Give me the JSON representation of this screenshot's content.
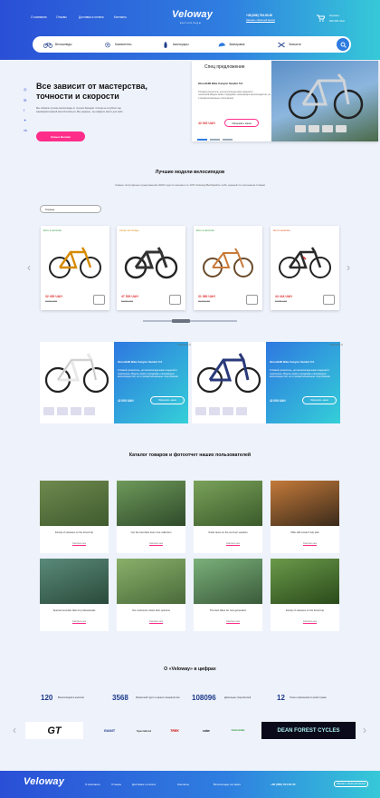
{
  "header": {
    "nav": [
      "О компании",
      "Отзывы",
      "Доставка и оплата",
      "Контакты"
    ],
    "logo": "Veloway",
    "logo_sub": "велосипеды",
    "phone": "+38 (066) 794-50-50",
    "callback": "Заказать обратный звонок",
    "cart_label": "Корзина",
    "cart_sum": "000 000 UAH"
  },
  "categories": [
    "Велосипеды",
    "Компоненты",
    "Аксессуары",
    "Экипировка",
    "Запчасти"
  ],
  "hero": {
    "title": "Все зависит от мастерства, точности и скорости",
    "text": "Мы собрали лучшие велосипеды от лучших брендов. Слоган не в рублях: мы занимаемся вашей мечтой кататься. Мы уверены - вы найдёте место для себя.",
    "button": "Новые Велики"
  },
  "offer": {
    "heading": "Спец предложение",
    "name": "Ghost/Hill Bike Canyon Sender 5.0",
    "desc": "Топовый ускоритель, для велосипеда каких моделей и чемпионов.Модель может порадовать начинающих велосипедистов, но и профессиональных спортсменов.",
    "price": "42 000 UAH",
    "button": "Оформить заказ"
  },
  "best": {
    "title": "Лучшие модели велосипедов",
    "subtitle": "Самые популярные предложения 2020 года по мнению по 10% Veloway.Выбирайте себе нужный по ключевым словам",
    "select": "Горные",
    "products": [
      {
        "badge": "Есть в наличии",
        "badge_color": "#2a9a3a",
        "price": "32 450 UAH",
        "old": "33 900 UAH"
      },
      {
        "badge": "Скоро на складе",
        "badge_color": "#d68a00",
        "price": "47 530 UAH",
        "old": "53 960 UAH"
      },
      {
        "badge": "Есть в наличии",
        "badge_color": "#2a9a3a",
        "price": "31 980 UAH",
        "old": "38 200 UAH"
      },
      {
        "badge": "Нет в наличии",
        "badge_color": "#e05020",
        "price": "44 444 UAH",
        "old": "48 875 UAH"
      }
    ]
  },
  "featured": [
    {
      "tag": "Новинка в 1х",
      "name": "Ghost/Hill Bike Canyon Sender 5.0",
      "desc": "Топовый ускоритель, для велосипеда каких моделей и чемпионов. Модель может порадовать начинающих велосипедистов, но и профессиональных спортсменов.",
      "price": "42 000 UAH",
      "button": "Оформить заказ"
    },
    {
      "tag": "Новинка в 1х",
      "name": "Ghost/Hill Bike Canyon Sender 5.0",
      "desc": "Топовый ускоритель, для велосипеда каких моделей и чемпионов. Модель может порадовать начинающих велосипедистов, но и профессиональных спортсменов.",
      "price": "42 000 UAH",
      "button": "Оформить заказ"
    }
  ],
  "gallery": {
    "title": "Каталог товаров и фотоотчет наших пользователей",
    "link": "Смотреть все",
    "items": [
      "Family of velosses on the forest trip",
      "Our the best bike lover nice collection",
      "Smile races on the summer vacation",
      "Offer still remain’t tidy plan",
      "Special mountain bike for professionals",
      "Our customers share their opinions",
      "The best bikes for new generation",
      "Family of velosses on the forest trip"
    ]
  },
  "stats": {
    "title": "О «Veloway» в цифрах",
    "items": [
      {
        "n": "120",
        "t": "Велосипедов в наличии"
      },
      {
        "n": "3568",
        "t": "Ремонтной групп и наших специалистов"
      },
      {
        "n": "108096",
        "t": "Довольных покупателей"
      },
      {
        "n": "12",
        "t": "Точек и филиалов по всей стране"
      }
    ]
  },
  "brands": [
    "GT",
    "GIANT",
    "Specialized",
    "TREK",
    "cube",
    "Cannondale",
    "DEAN FOREST CYCLES"
  ],
  "footer": {
    "logo": "Veloway",
    "nav": [
      "О компании",
      "Отзывы",
      "Доставка и оплата",
      "Контакты",
      "Велосипеды на заказ"
    ],
    "phone": "+38 (066) 794-50-50",
    "callback": "Заказать обратный звонок"
  }
}
